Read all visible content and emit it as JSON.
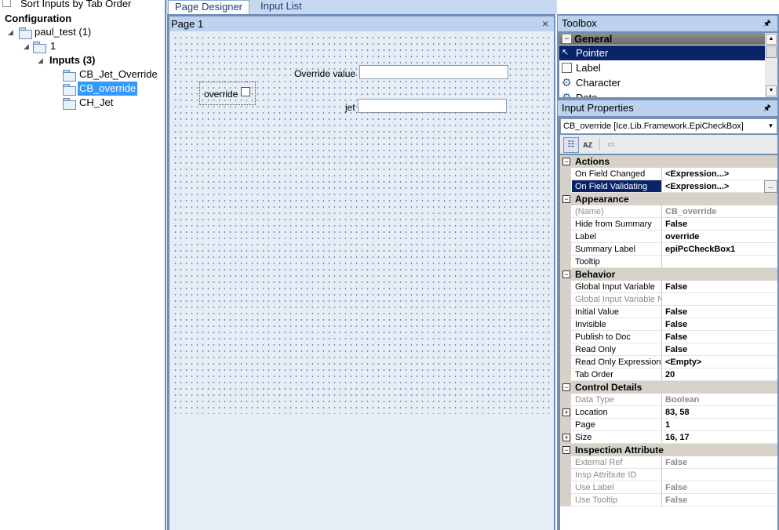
{
  "left_panel": {
    "sort_label": "Sort Inputs by Tab Order",
    "config_title": "Configuration",
    "tree": [
      {
        "label": "paul_test (1)"
      },
      {
        "label": "1"
      },
      {
        "label": "Inputs (3)"
      },
      {
        "label": "CB_Jet_Override"
      },
      {
        "label": "CB_override",
        "selected": true
      },
      {
        "label": "CH_Jet"
      }
    ]
  },
  "tabs": [
    {
      "label": "Page Designer",
      "active": true
    },
    {
      "label": "Input List"
    }
  ],
  "designer": {
    "page_title": "Page 1",
    "close_glyph": "×",
    "fields": {
      "override_value_label": "Override value",
      "override_label": "override",
      "jet_label": "jet"
    }
  },
  "toolbox": {
    "title": "Toolbox",
    "pin": "🖈",
    "group": "General",
    "items": [
      {
        "label": "Pointer",
        "icon": "pointer-icon",
        "selected": true
      },
      {
        "label": "Label",
        "icon": "label-icon"
      },
      {
        "label": "Character",
        "icon": "gear-icon"
      },
      {
        "label": "Date",
        "icon": "gear-icon"
      }
    ]
  },
  "properties": {
    "title": "Input Properties",
    "pin": "🖈",
    "selected_object": "CB_override [Ice.Lib.Framework.EpiCheckBox]",
    "toolbar": {
      "categorized": "☷",
      "alpha": "AZ",
      "pages": "▭"
    },
    "categories": [
      {
        "name": "Actions",
        "rows": [
          {
            "name": "On Field Changed",
            "value": "<Expression...>"
          },
          {
            "name": "On Field Validating",
            "value": "<Expression...>",
            "selected": true,
            "ellipsis": "..."
          }
        ]
      },
      {
        "name": "Appearance",
        "rows": [
          {
            "name": "(Name)",
            "value": "CB_override",
            "disabled": true
          },
          {
            "name": "Hide from Summary",
            "value": "False"
          },
          {
            "name": "Label",
            "value": "override"
          },
          {
            "name": "Summary Label",
            "value": "epiPcCheckBox1"
          },
          {
            "name": "Tooltip",
            "value": ""
          }
        ]
      },
      {
        "name": "Behavior",
        "rows": [
          {
            "name": "Global Input Variable",
            "value": "False"
          },
          {
            "name": "Global Input Variable Na",
            "value": "",
            "disabled": true
          },
          {
            "name": "Initial Value",
            "value": "False"
          },
          {
            "name": "Invisible",
            "value": "False"
          },
          {
            "name": "Publish to Doc",
            "value": "False"
          },
          {
            "name": "Read Only",
            "value": "False"
          },
          {
            "name": "Read Only Expression",
            "value": "<Empty>"
          },
          {
            "name": "Tab Order",
            "value": "20"
          }
        ]
      },
      {
        "name": "Control Details",
        "rows": [
          {
            "name": "Data Type",
            "value": "Boolean",
            "disabled": true
          },
          {
            "name": "Location",
            "value": "83, 58",
            "expandable": true
          },
          {
            "name": "Page",
            "value": "1"
          },
          {
            "name": "Size",
            "value": "16, 17",
            "expandable": true
          }
        ]
      },
      {
        "name": "Inspection Attribute",
        "rows": [
          {
            "name": "External Ref",
            "value": "False",
            "disabled": true
          },
          {
            "name": "Insp Attribute ID",
            "value": "",
            "disabled": true
          },
          {
            "name": "Use Label",
            "value": "False",
            "disabled": true
          },
          {
            "name": "Use Tooltip",
            "value": "False",
            "disabled": true
          }
        ]
      }
    ]
  }
}
